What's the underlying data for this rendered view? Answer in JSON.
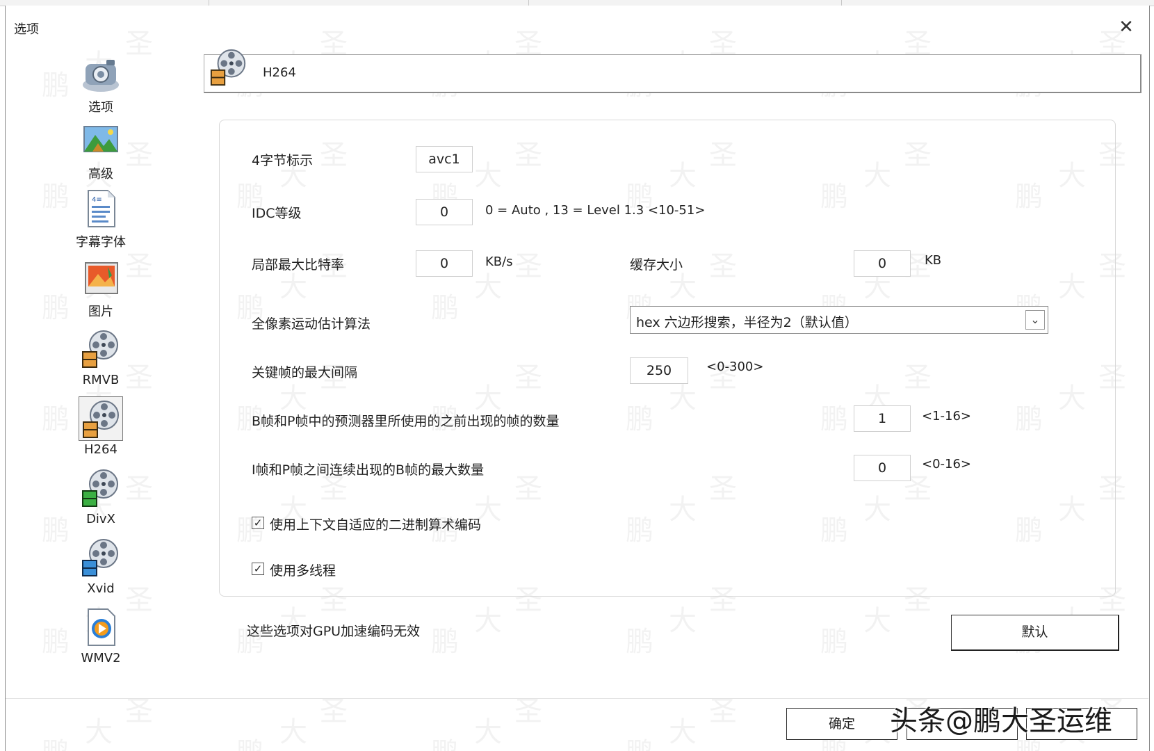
{
  "window": {
    "title": "选项",
    "close_label": "✕"
  },
  "sidebar": {
    "items": [
      {
        "label": "选项"
      },
      {
        "label": "高级"
      },
      {
        "label": "字幕字体"
      },
      {
        "label": "图片"
      },
      {
        "label": "RMVB"
      },
      {
        "label": "H264"
      },
      {
        "label": "DivX"
      },
      {
        "label": "Xvid"
      },
      {
        "label": "WMV2"
      }
    ],
    "selected": "H264"
  },
  "header": {
    "title": "H264"
  },
  "form": {
    "fourcc": {
      "label": "4字节标示",
      "value": "avc1"
    },
    "idc": {
      "label": "IDC等级",
      "value": "0",
      "hint": "0 = Auto , 13 = Level 1.3 <10-51>"
    },
    "max_bitrate": {
      "label": "局部最大比特率",
      "value": "0",
      "unit": "KB/s"
    },
    "buffer": {
      "label": "缓存大小",
      "value": "0",
      "unit": "KB"
    },
    "me_algorithm": {
      "label": "全像素运动估计算法",
      "value": "hex  六边形搜索，半径为2（默认值）"
    },
    "keyint": {
      "label": "关键帧的最大间隔",
      "value": "250",
      "range": "<0-300>"
    },
    "refs": {
      "label": "B帧和P帧中的预测器里所使用的之前出现的帧的数量",
      "value": "1",
      "range": "<1-16>"
    },
    "bframes": {
      "label": "I帧和P帧之间连续出现的B帧的最大数量",
      "value": "0",
      "range": "<0-16>"
    },
    "cabac": {
      "label": "使用上下文自适应的二进制算术编码",
      "checked": true
    },
    "threads": {
      "label": "使用多线程",
      "checked": true
    }
  },
  "note": "这些选项对GPU加速编码无效",
  "buttons": {
    "default": "默认",
    "ok": "确定"
  },
  "watermark_overlay": "头条@鹏大圣运维",
  "watermark_chars": [
    "鹏",
    "大",
    "圣"
  ],
  "colors": {
    "border": "#8a8a8a",
    "film_orange": "#e8a040",
    "film_green": "#3cb043",
    "film_blue": "#3a8fd8"
  }
}
